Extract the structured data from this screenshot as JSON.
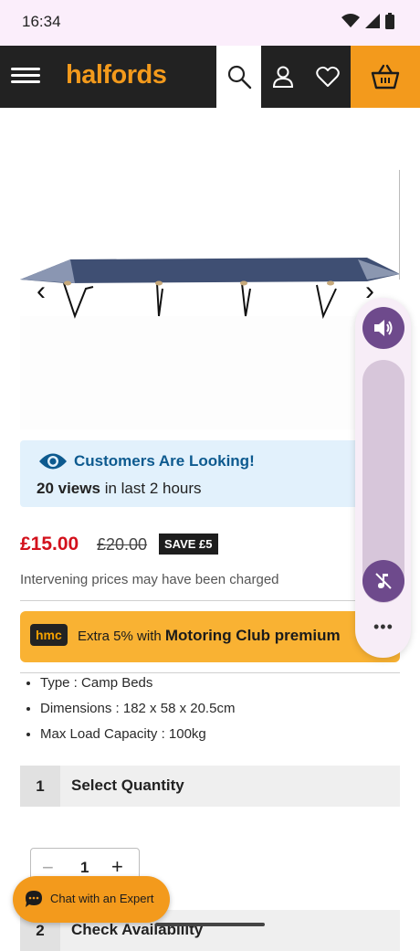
{
  "status_bar": {
    "time": "16:34",
    "icons": [
      "wifi-icon",
      "signal-icon",
      "battery-icon"
    ]
  },
  "header": {
    "logo": "halfords",
    "icons": [
      "menu-icon",
      "search-icon",
      "account-icon",
      "heart-icon",
      "basket-icon"
    ],
    "brand_color": "#f39a1c",
    "bar_color": "#222222"
  },
  "carousel": {
    "prev_label": "‹",
    "next_label": "›"
  },
  "looking": {
    "title": "Customers Are Looking!",
    "views": "20 views",
    "suffix": "in last 2 hours"
  },
  "price": {
    "current": "£15.00",
    "was": "£20.00",
    "save": "SAVE £5",
    "note": "Intervening prices may have been charged",
    "current_color": "#d3111c"
  },
  "hmc": {
    "badge": "hmc",
    "text": "Extra 5% with",
    "bold": "Motoring Club premium"
  },
  "features": [
    "Type : Camp Beds",
    "Dimensions : 182 x 58 x 20.5cm",
    "Max Load Capacity : 100kg"
  ],
  "quantity_section": {
    "number": "1",
    "label": "Select Quantity",
    "value": "1",
    "minus": "−",
    "plus": "+"
  },
  "availability_section": {
    "number": "2",
    "label": "Check Availability"
  },
  "chat": {
    "label": "Chat with an Expert"
  },
  "volume_panel": {
    "more": "•••",
    "accent": "#6e4a8c"
  }
}
